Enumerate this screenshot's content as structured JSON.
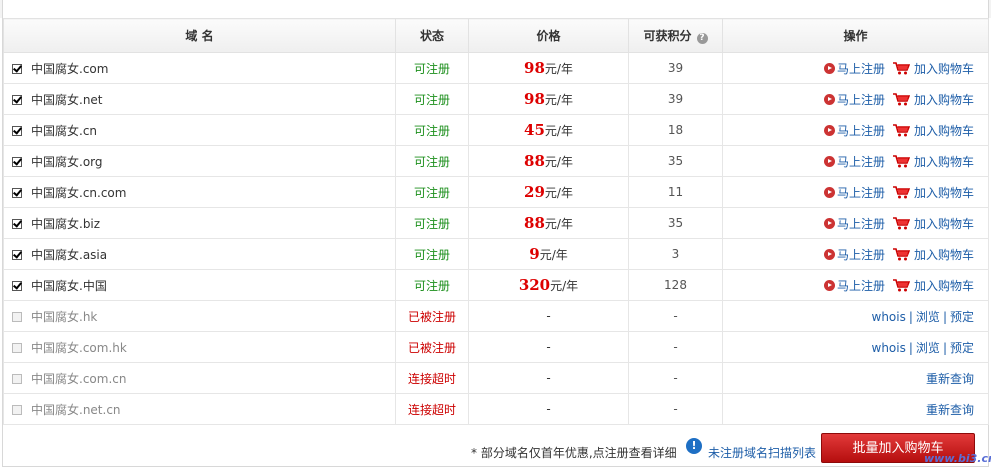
{
  "table": {
    "headers": {
      "domain": "域 名",
      "status": "状态",
      "price": "价格",
      "points": "可获积分",
      "actions": "操作"
    },
    "rows": [
      {
        "name": "中国腐女.com",
        "checked": true,
        "status": "可注册",
        "price": "98",
        "unit": "元/年",
        "points": "39",
        "action": "register"
      },
      {
        "name": "中国腐女.net",
        "checked": true,
        "status": "可注册",
        "price": "98",
        "unit": "元/年",
        "points": "39",
        "action": "register"
      },
      {
        "name": "中国腐女.cn",
        "checked": true,
        "status": "可注册",
        "price": "45",
        "unit": "元/年",
        "points": "18",
        "action": "register"
      },
      {
        "name": "中国腐女.org",
        "checked": true,
        "status": "可注册",
        "price": "88",
        "unit": "元/年",
        "points": "35",
        "action": "register"
      },
      {
        "name": "中国腐女.cn.com",
        "checked": true,
        "status": "可注册",
        "price": "29",
        "unit": "元/年",
        "points": "11",
        "action": "register"
      },
      {
        "name": "中国腐女.biz",
        "checked": true,
        "status": "可注册",
        "price": "88",
        "unit": "元/年",
        "points": "35",
        "action": "register"
      },
      {
        "name": "中国腐女.asia",
        "checked": true,
        "status": "可注册",
        "price": "9",
        "unit": "元/年",
        "points": "3",
        "action": "register"
      },
      {
        "name": "中国腐女.中国",
        "checked": true,
        "status": "可注册",
        "price": "320",
        "unit": "元/年",
        "points": "128",
        "action": "register"
      },
      {
        "name": "中国腐女.hk",
        "checked": false,
        "status": "已被注册",
        "price": "-",
        "unit": "",
        "points": "-",
        "action": "whois"
      },
      {
        "name": "中国腐女.com.hk",
        "checked": false,
        "status": "已被注册",
        "price": "-",
        "unit": "",
        "points": "-",
        "action": "whois"
      },
      {
        "name": "中国腐女.com.cn",
        "checked": false,
        "status": "连接超时",
        "price": "-",
        "unit": "",
        "points": "-",
        "action": "retry"
      },
      {
        "name": "中国腐女.net.cn",
        "checked": false,
        "status": "连接超时",
        "price": "-",
        "unit": "",
        "points": "-",
        "action": "retry"
      }
    ]
  },
  "actions": {
    "register": "马上注册",
    "add_cart": "加入购物车",
    "whois": "whois",
    "browse": "浏览",
    "reserve": "预定",
    "retry": "重新查询",
    "sep": "|"
  },
  "icons": {
    "help": "?",
    "warning": "!",
    "register": "play-icon",
    "cart": "cart-icon"
  },
  "footer": {
    "note": "* 部分域名仅首年优惠,点注册查看详细",
    "scan_link": "未注册域名扫描列表",
    "batch_button": "批量加入购物车"
  },
  "watermark": "www.bi3.cn",
  "colors": {
    "available": "#1c8f1c",
    "taken": "#cc0000",
    "price": "#dd0000",
    "link": "#1e5ea8",
    "button": "#c81f1f"
  }
}
